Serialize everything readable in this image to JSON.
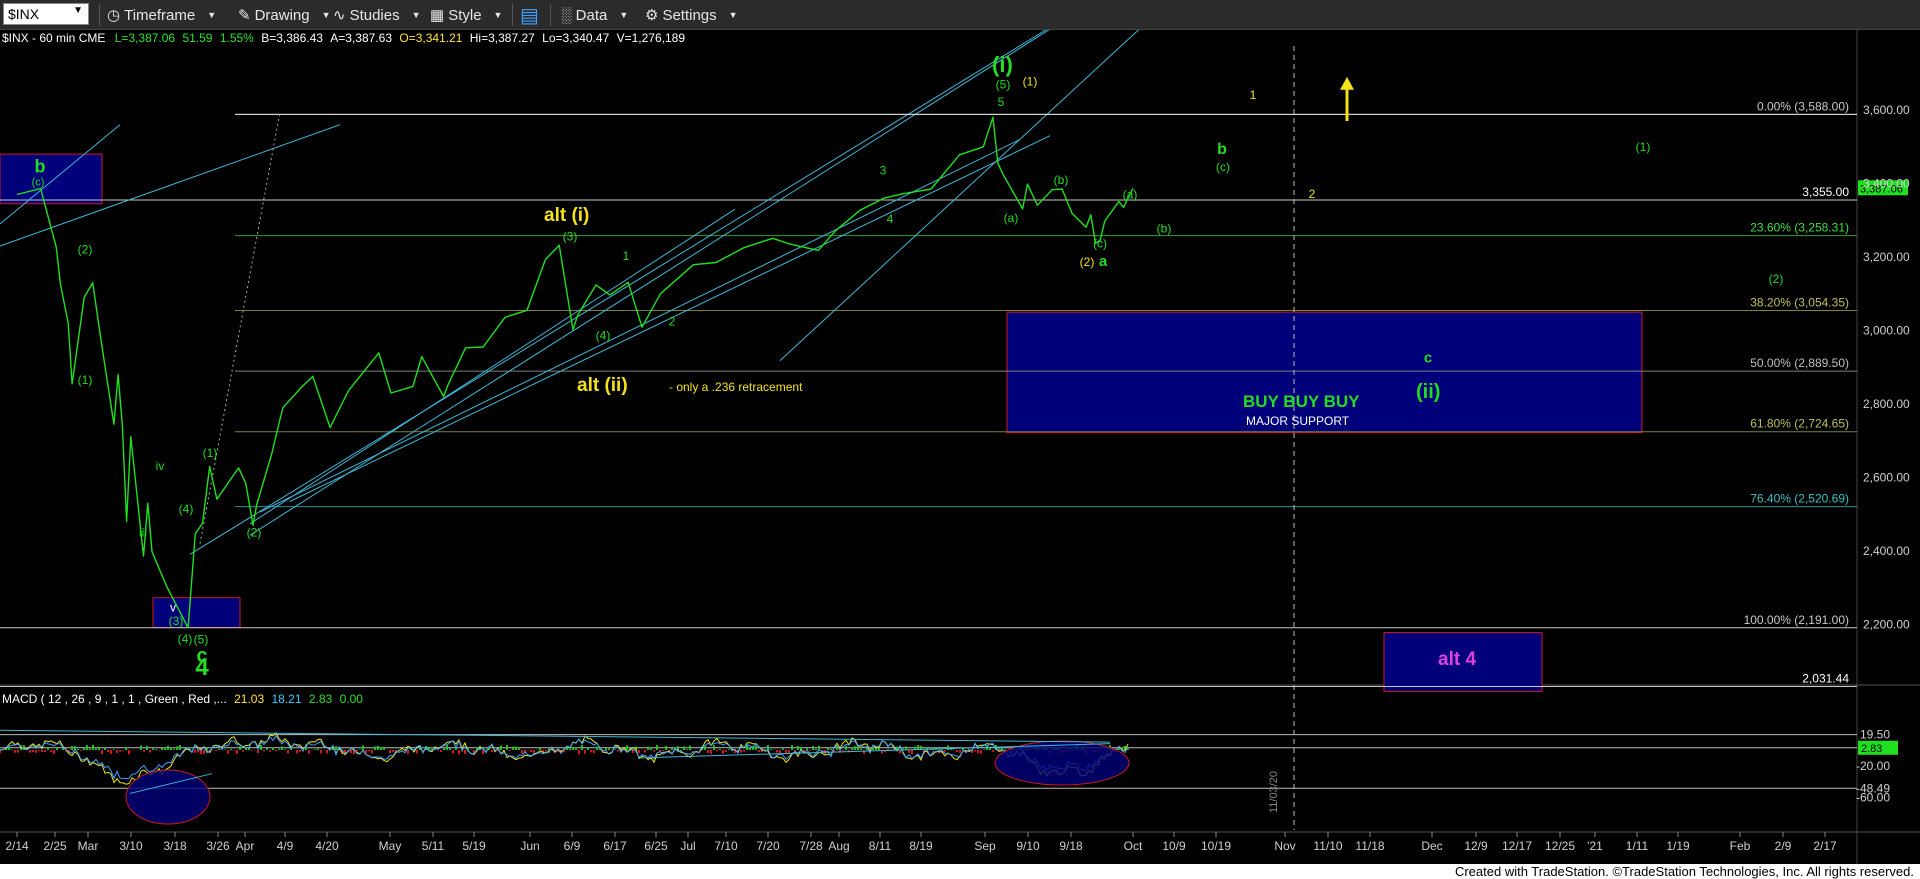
{
  "toolbar": {
    "symbol": "$INX",
    "timeframe": "Timeframe",
    "drawing": "Drawing",
    "studies": "Studies",
    "style": "Style",
    "data": "Data",
    "settings": "Settings"
  },
  "header": {
    "label": "$INX - 60 min  CME",
    "last": "L=3,387.06",
    "chg": "51.59",
    "pct": "1.55%",
    "bid": "B=3,386.43",
    "ask": "A=3,387.63",
    "open": "O=3,341.21",
    "high": "Hi=3,387.27",
    "low": "Lo=3,340.47",
    "vol": "V=1,276,189"
  },
  "macd_header": {
    "label": "MACD ( 12 , 26 , 9 , 1 , 1 , Green , Red ,...",
    "v1": "21.03",
    "v2": "18.21",
    "v3": "2.83",
    "v4": "0.00"
  },
  "footer": {
    "text": "Created with TradeStation. ©TradeStation Technologies, Inc. All rights reserved."
  },
  "colors": {
    "price": "#1fe01f",
    "channel": "#3fb8d8",
    "fib": "#7fbf3f",
    "box": "#00007a",
    "box_border": "#d01818",
    "wave_yellow": "#f2e21c",
    "wave_green": "#22dd22",
    "alt4": "#e040e0"
  },
  "chart_data": {
    "type": "line",
    "title": "$INX - 60 min",
    "y_axis": {
      "ticks": [
        3600,
        3400,
        3200,
        3000,
        2800,
        2600,
        2400,
        2200
      ],
      "labels": [
        "3,600.00",
        "3,400.00",
        "3,200.00",
        "3,000.00",
        "2,800.00",
        "2,600.00",
        "2,400.00",
        "2,200.00"
      ]
    },
    "x_axis": {
      "labels": [
        "2/14",
        "2/25",
        "Mar",
        "3/10",
        "3/18",
        "3/26",
        "Apr",
        "4/9",
        "4/20",
        "May",
        "5/11",
        "5/19",
        "Jun",
        "6/9",
        "6/17",
        "6/25",
        "Jul",
        "7/10",
        "7/20",
        "7/28",
        "Aug",
        "8/11",
        "8/19",
        "Sep",
        "9/10",
        "9/18",
        "Oct",
        "10/9",
        "10/19",
        "Nov",
        "11/10",
        "11/18",
        "Dec",
        "12/9",
        "12/17",
        "12/25",
        "'21",
        "1/11",
        "1/19",
        "Feb",
        "2/9",
        "2/17"
      ]
    },
    "price_series": {
      "name": "$INX",
      "points": [
        [
          "2/14",
          3370
        ],
        [
          "2/20",
          3386
        ],
        [
          "2/24",
          3225
        ],
        [
          "2/25",
          3128
        ],
        [
          "2/27",
          3020
        ],
        [
          "2/28",
          2855
        ],
        [
          "3/2",
          3090
        ],
        [
          "3/4",
          3130
        ],
        [
          "3/6",
          2970
        ],
        [
          "3/9",
          2745
        ],
        [
          "3/10",
          2880
        ],
        [
          "3/11",
          2740
        ],
        [
          "3/12",
          2480
        ],
        [
          "3/13",
          2711
        ],
        [
          "3/16",
          2386
        ],
        [
          "3/17",
          2530
        ],
        [
          "3/18",
          2398
        ],
        [
          "3/20",
          2305
        ],
        [
          "3/23",
          2191
        ],
        [
          "3/24",
          2447
        ],
        [
          "3/25",
          2475
        ],
        [
          "3/26",
          2630
        ],
        [
          "3/27",
          2541
        ],
        [
          "3/30",
          2626
        ],
        [
          "3/31",
          2584
        ],
        [
          "4/1",
          2470
        ],
        [
          "4/2",
          2526
        ],
        [
          "4/6",
          2664
        ],
        [
          "4/8",
          2750
        ],
        [
          "4/9",
          2790
        ],
        [
          "4/14",
          2846
        ],
        [
          "4/17",
          2875
        ],
        [
          "4/21",
          2736
        ],
        [
          "4/24",
          2836
        ],
        [
          "4/29",
          2939
        ],
        [
          "5/1",
          2830
        ],
        [
          "5/6",
          2848
        ],
        [
          "5/8",
          2929
        ],
        [
          "5/13",
          2820
        ],
        [
          "5/14",
          2852
        ],
        [
          "5/18",
          2953
        ],
        [
          "5/22",
          2955
        ],
        [
          "5/27",
          3036
        ],
        [
          "6/1",
          3055
        ],
        [
          "6/5",
          3193
        ],
        [
          "6/8",
          3232
        ],
        [
          "6/11",
          3002
        ],
        [
          "6/12",
          3041
        ],
        [
          "6/16",
          3124
        ],
        [
          "6/19",
          3097
        ],
        [
          "6/23",
          3131
        ],
        [
          "6/26",
          3009
        ],
        [
          "6/30",
          3100
        ],
        [
          "7/6",
          3179
        ],
        [
          "7/10",
          3185
        ],
        [
          "7/15",
          3226
        ],
        [
          "7/20",
          3251
        ],
        [
          "7/23",
          3235
        ],
        [
          "7/28",
          3218
        ],
        [
          "7/31",
          3271
        ],
        [
          "8/5",
          3327
        ],
        [
          "8/10",
          3360
        ],
        [
          "8/14",
          3372
        ],
        [
          "8/20",
          3385
        ],
        [
          "8/26",
          3478
        ],
        [
          "8/31",
          3500
        ],
        [
          "9/2",
          3580
        ],
        [
          "9/3",
          3455
        ],
        [
          "9/4",
          3426
        ],
        [
          "9/8",
          3331
        ],
        [
          "9/9",
          3398
        ],
        [
          "9/11",
          3341
        ],
        [
          "9/14",
          3383
        ],
        [
          "9/16",
          3385
        ],
        [
          "9/18",
          3319
        ],
        [
          "9/21",
          3281
        ],
        [
          "9/22",
          3315
        ],
        [
          "9/23",
          3237
        ],
        [
          "9/24",
          3246
        ],
        [
          "9/25",
          3298
        ],
        [
          "9/28",
          3351
        ],
        [
          "9/29",
          3335
        ],
        [
          "9/30",
          3363
        ],
        [
          "10/1",
          3387
        ]
      ]
    },
    "fib_levels": [
      {
        "label": "0.00% (3,588.00)",
        "value": 3588
      },
      {
        "label": "3,355.00",
        "value": 3355
      },
      {
        "label": "23.60% (3,258.31)",
        "value": 3258.31
      },
      {
        "label": "38.20% (3,054.35)",
        "value": 3054.35
      },
      {
        "label": "50.00% (2,889.50)",
        "value": 2889.5
      },
      {
        "label": "61.80% (2,724.65)",
        "value": 2724.65
      },
      {
        "label": "76.40% (2,520.69)",
        "value": 2520.69
      },
      {
        "label": "100.00% (2,191.00)",
        "value": 2191
      },
      {
        "label": "2,031.44",
        "value": 2031.44
      }
    ],
    "last_price_tag": "3,387.06",
    "macd": {
      "labels": [
        "19.50",
        "2.83",
        "-20.00",
        "-48.49",
        "-60.00"
      ],
      "levels": [
        19.5,
        2.83,
        -20,
        -48.49,
        -60
      ]
    },
    "annotations": {
      "buy_box": {
        "line1": "BUY BUY BUY",
        "line2": "MAJOR SUPPORT"
      },
      "alt4": "alt 4",
      "alt_i": "alt (i)",
      "alt_ii": "alt (ii)",
      "alt_ii_note": "- only a .236 retracement",
      "wave_i": "(i)",
      "wave_ii": "(ii)",
      "vertical_date": "11/03/20"
    }
  }
}
